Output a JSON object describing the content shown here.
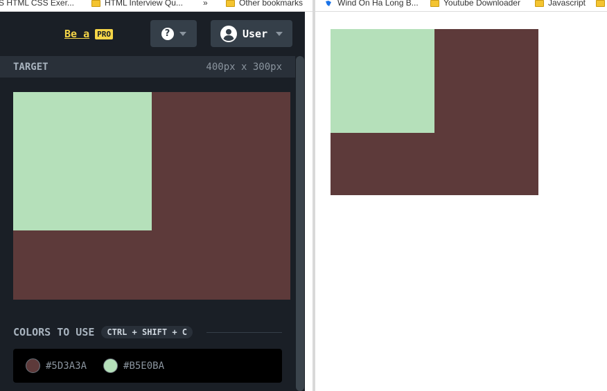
{
  "bookmarks_left": [
    {
      "label": "S HTML CSS Exer..."
    },
    {
      "label": "HTML Interview Qu..."
    },
    {
      "label": "»"
    },
    {
      "label": "Other bookmarks"
    }
  ],
  "bookmarks_right": [
    {
      "label": "Wind On Ha Long B..."
    },
    {
      "label": "Youtube Downloader"
    },
    {
      "label": "Javascript"
    }
  ],
  "header": {
    "be_a": "Be a",
    "pro": "PRO",
    "user_label": "User"
  },
  "target": {
    "title": "TARGET",
    "size": "400px x 300px"
  },
  "colors": {
    "title": "COLORS TO USE",
    "shortcut": "CTRL + SHIFT + C",
    "swatches": [
      {
        "hex": "#5D3A3A",
        "color": "#5d3a3a"
      },
      {
        "hex": "#B5E0BA",
        "color": "#b5e0ba"
      }
    ]
  },
  "theme": {
    "background_color": "#5d3a3a",
    "square_color": "#b5e0ba",
    "accent": "#f5d547"
  }
}
